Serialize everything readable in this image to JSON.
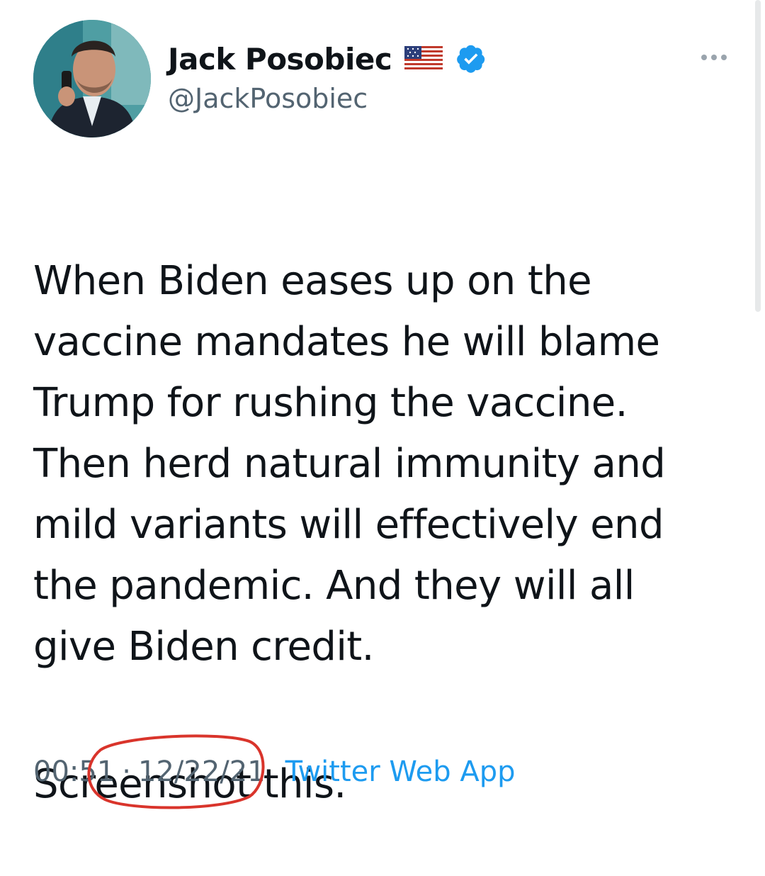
{
  "tweet": {
    "author": {
      "display_name": "Jack Posobiec",
      "handle": "@JackPosobiec",
      "flag_icon": "us-flag-icon",
      "verified_icon": "verified-badge-icon",
      "verified_color": "#1d9bf0"
    },
    "more_icon": "more-options-icon",
    "text_paragraphs": [
      "When Biden eases up on the\nvaccine mandates he will blame\nTrump for rushing the vaccine.\nThen herd natural immunity and\nmild variants will effectively end\nthe pandemic. And they will all\ngive Biden credit.",
      "Screenshot this."
    ],
    "time": "00:51",
    "separator": "·",
    "date": "12/22/21",
    "source": "Twitter Web App",
    "link_color": "#1d9bf0",
    "annotation_color": "#d9342b"
  }
}
